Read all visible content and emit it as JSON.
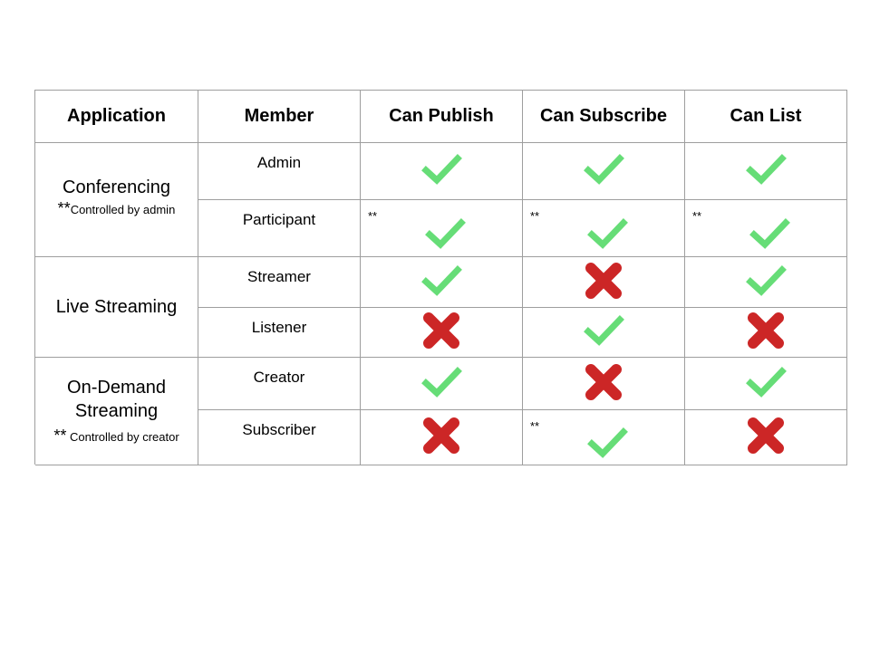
{
  "headers": [
    "Application",
    "Member",
    "Can Publish",
    "Can Subscribe",
    "Can List"
  ],
  "groups": [
    {
      "title": "Conferencing",
      "note_mark": "**",
      "note": "Controlled by admin",
      "rows": [
        {
          "member": "Admin",
          "cells": [
            {
              "value": "allowed",
              "mark": ""
            },
            {
              "value": "allowed",
              "mark": ""
            },
            {
              "value": "allowed",
              "mark": ""
            }
          ]
        },
        {
          "member": "Participant",
          "cells": [
            {
              "value": "allowed",
              "mark": "**"
            },
            {
              "value": "allowed",
              "mark": "**"
            },
            {
              "value": "allowed",
              "mark": "**"
            }
          ]
        }
      ]
    },
    {
      "title": "Live Streaming",
      "note_mark": "",
      "note": "",
      "rows": [
        {
          "member": "Streamer",
          "cells": [
            {
              "value": "allowed",
              "mark": ""
            },
            {
              "value": "denied",
              "mark": ""
            },
            {
              "value": "allowed",
              "mark": ""
            }
          ]
        },
        {
          "member": "Listener",
          "cells": [
            {
              "value": "denied",
              "mark": ""
            },
            {
              "value": "allowed",
              "mark": ""
            },
            {
              "value": "denied",
              "mark": ""
            }
          ]
        }
      ]
    },
    {
      "title": "On-Demand Streaming",
      "note_mark": "**",
      "note": "Controlled by creator",
      "rows": [
        {
          "member": "Creator",
          "cells": [
            {
              "value": "allowed",
              "mark": ""
            },
            {
              "value": "denied",
              "mark": ""
            },
            {
              "value": "allowed",
              "mark": ""
            }
          ]
        },
        {
          "member": "Subscriber",
          "cells": [
            {
              "value": "denied",
              "mark": ""
            },
            {
              "value": "allowed",
              "mark": "**"
            },
            {
              "value": "denied",
              "mark": ""
            }
          ]
        }
      ]
    }
  ],
  "icons": {
    "allowed": "check-icon",
    "denied": "cross-icon"
  },
  "colors": {
    "check": "#66dd77",
    "cross": "#cc2626",
    "border": "#9e9e9e"
  }
}
